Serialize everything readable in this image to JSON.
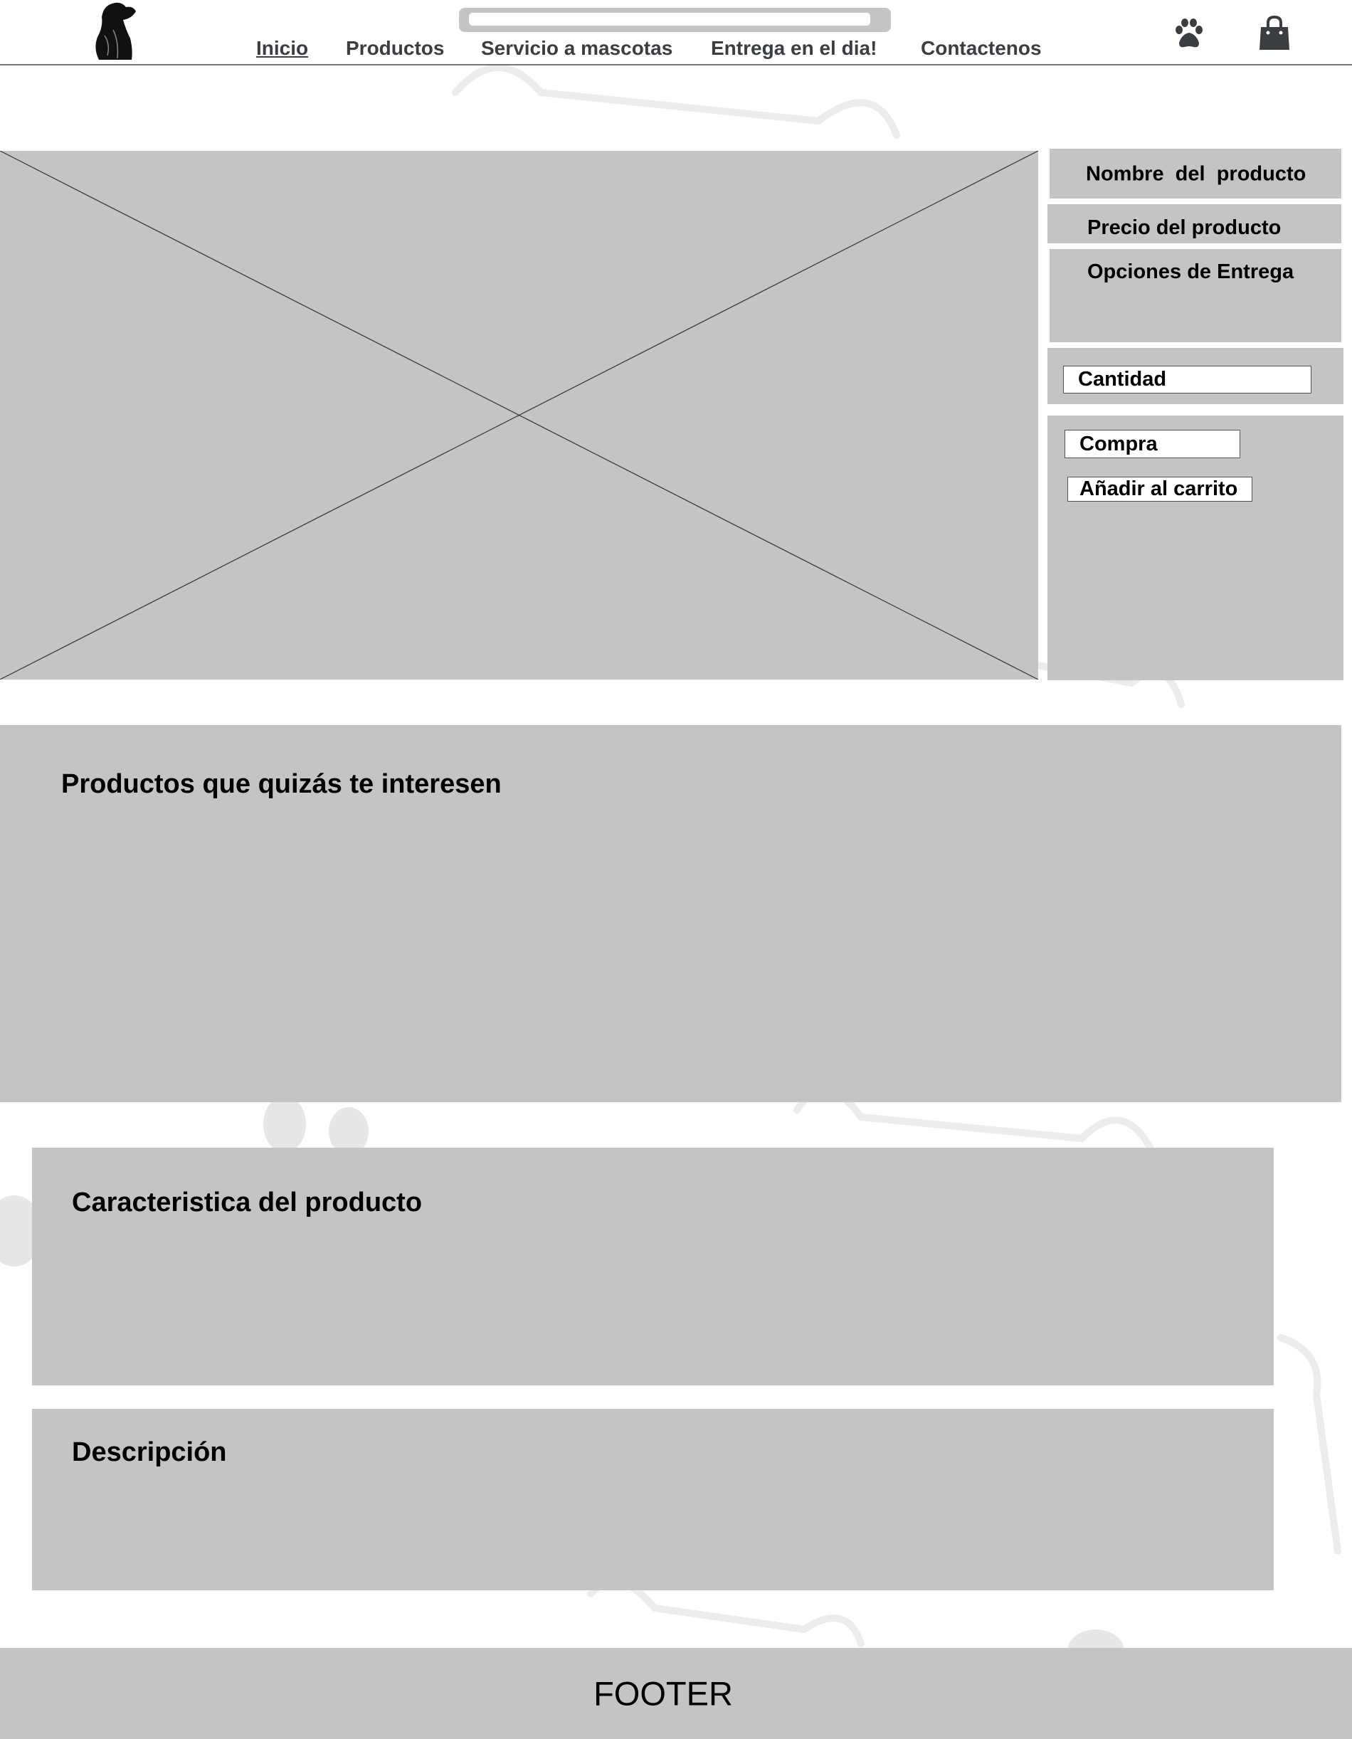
{
  "header": {
    "logo": "dog-silhouette-logo",
    "search": {
      "value": "",
      "placeholder": ""
    },
    "nav": [
      {
        "label": "Inicio",
        "active": true
      },
      {
        "label": "Productos"
      },
      {
        "label": "Servicio a mascotas"
      },
      {
        "label": "Entrega en el dia!"
      },
      {
        "label": "Contactenos"
      }
    ],
    "icons": [
      "paw-icon",
      "shopping-bag-icon"
    ]
  },
  "product": {
    "image": "image-placeholder",
    "name": "Nombre  del  producto",
    "price": "Precio del producto",
    "delivery": "Opciones de Entrega",
    "quantity": "Cantidad",
    "buy": "Compra",
    "add_to_cart": "Añadir al carrito"
  },
  "related": {
    "title": "Productos que quizás te interesen"
  },
  "features": {
    "title": "Caracteristica del producto"
  },
  "description": {
    "title": "Descripción"
  },
  "footer": {
    "label": "FOOTER"
  },
  "colors": {
    "placeholder": "#c4c4c4",
    "nav_text": "#3a3d42"
  }
}
